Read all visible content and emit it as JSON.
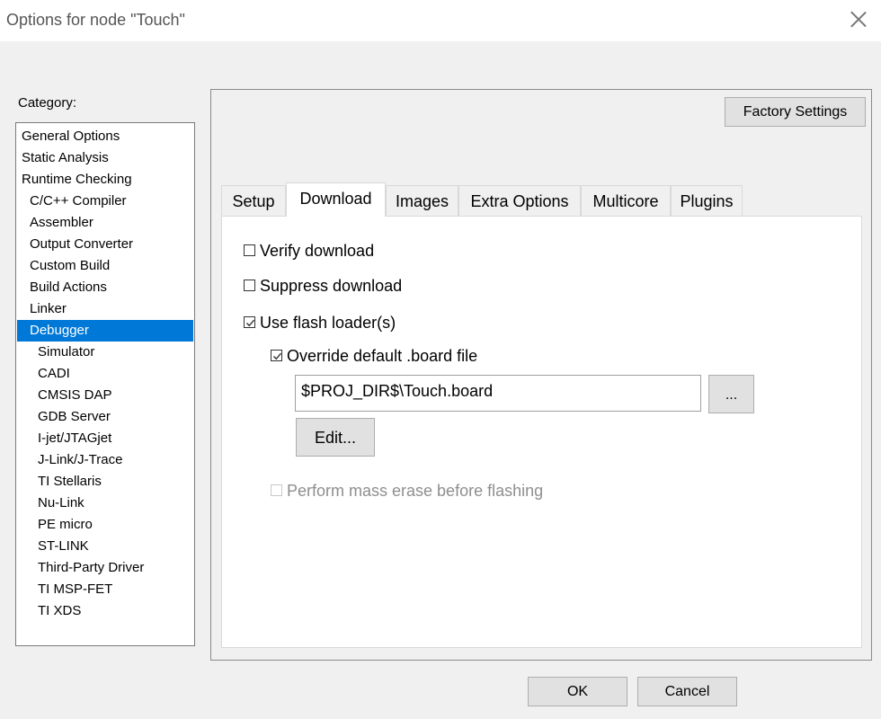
{
  "window": {
    "title": "Options for node \"Touch\"",
    "close_icon": "close-icon"
  },
  "category": {
    "label": "Category:",
    "items": [
      {
        "label": "General Options",
        "level": 0
      },
      {
        "label": "Static Analysis",
        "level": 0
      },
      {
        "label": "Runtime Checking",
        "level": 0
      },
      {
        "label": "C/C++ Compiler",
        "level": 1
      },
      {
        "label": "Assembler",
        "level": 1
      },
      {
        "label": "Output Converter",
        "level": 1
      },
      {
        "label": "Custom Build",
        "level": 1
      },
      {
        "label": "Build Actions",
        "level": 1
      },
      {
        "label": "Linker",
        "level": 1
      },
      {
        "label": "Debugger",
        "level": 1,
        "selected": true
      },
      {
        "label": "Simulator",
        "level": 2
      },
      {
        "label": "CADI",
        "level": 2
      },
      {
        "label": "CMSIS DAP",
        "level": 2
      },
      {
        "label": "GDB Server",
        "level": 2
      },
      {
        "label": "I-jet/JTAGjet",
        "level": 2
      },
      {
        "label": "J-Link/J-Trace",
        "level": 2
      },
      {
        "label": "TI Stellaris",
        "level": 2
      },
      {
        "label": "Nu-Link",
        "level": 2
      },
      {
        "label": "PE micro",
        "level": 2
      },
      {
        "label": "ST-LINK",
        "level": 2
      },
      {
        "label": "Third-Party Driver",
        "level": 2
      },
      {
        "label": "TI MSP-FET",
        "level": 2
      },
      {
        "label": "TI XDS",
        "level": 2
      }
    ]
  },
  "factory_settings_label": "Factory Settings",
  "tabs": [
    {
      "label": "Setup"
    },
    {
      "label": "Download",
      "active": true
    },
    {
      "label": "Images"
    },
    {
      "label": "Extra Options"
    },
    {
      "label": "Multicore"
    },
    {
      "label": "Plugins"
    }
  ],
  "download": {
    "verify_download": {
      "label": "Verify download",
      "checked": false
    },
    "suppress_download": {
      "label": "Suppress download",
      "checked": false
    },
    "use_flash_loader": {
      "label": "Use flash loader(s)",
      "checked": true
    },
    "override_board_file": {
      "label": "Override default .board file",
      "checked": true
    },
    "board_file_path": "$PROJ_DIR$\\Touch.board",
    "browse_label": "...",
    "edit_label": "Edit...",
    "mass_erase": {
      "label": "Perform mass erase before flashing",
      "checked": false,
      "enabled": false
    }
  },
  "footer": {
    "ok_label": "OK",
    "cancel_label": "Cancel"
  },
  "colors": {
    "selection": "#0078d7",
    "window_bg": "#f0f0f0",
    "button_bg": "#e1e1e1"
  }
}
